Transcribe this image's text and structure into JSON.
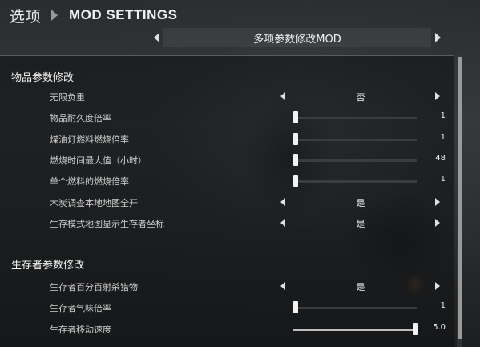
{
  "header": {
    "back_label": "选项",
    "title": "MOD SETTINGS"
  },
  "mod_selector": {
    "value": "多项参数修改MOD"
  },
  "sections": [
    {
      "title": "物品参数修改",
      "rows": [
        {
          "label": "无限负重",
          "type": "option",
          "value": "否"
        },
        {
          "label": "物品耐久度倍率",
          "type": "slider",
          "value": "1",
          "level": 0.0
        },
        {
          "label": "煤油灯燃料燃烧倍率",
          "type": "slider",
          "value": "1",
          "level": 0.0
        },
        {
          "label": "燃烧时间最大值（小时）",
          "type": "slider",
          "value": "48",
          "level": 0.0
        },
        {
          "label": "单个燃料的燃烧倍率",
          "type": "slider",
          "value": "1",
          "level": 0.0
        },
        {
          "label": "木炭调查本地地图全开",
          "type": "option",
          "value": "是"
        },
        {
          "label": "生存模式地图显示生存者坐标",
          "type": "option",
          "value": "是"
        }
      ]
    },
    {
      "title": "生存者参数修改",
      "rows": [
        {
          "label": "生存者百分百射杀猎物",
          "type": "option",
          "value": "是"
        },
        {
          "label": "生存者气味倍率",
          "type": "slider",
          "value": "1",
          "level": 0.0
        },
        {
          "label": "生存者移动速度",
          "type": "slider",
          "value": "5.0",
          "level": 1.0
        }
      ]
    }
  ],
  "colors": {
    "text": "#d8d8d8",
    "panel": "#121415",
    "knob": "#f2f2f2"
  }
}
